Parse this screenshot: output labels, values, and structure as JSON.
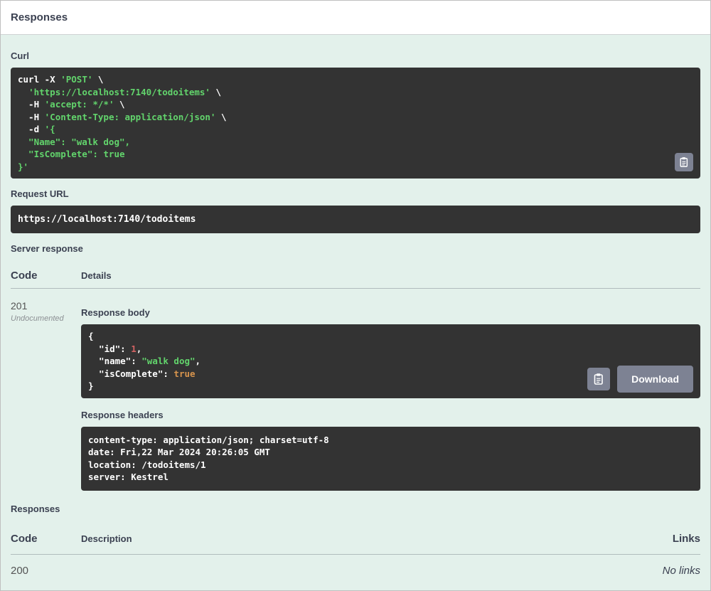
{
  "colors": {
    "section_background": "#e3f1eb",
    "code_background": "#333333",
    "string_green": "#62d46c",
    "number_red": "#d36363",
    "boolean_orange": "#d7944d",
    "button_gray": "#7d8293",
    "heading_text": "#3b4151"
  },
  "header": {
    "title": "Responses"
  },
  "curl": {
    "label": "Curl",
    "tokens": [
      [
        {
          "t": "curl -X ",
          "c": "plain"
        },
        {
          "t": "'POST'",
          "c": "string"
        },
        {
          "t": " \\",
          "c": "plain"
        }
      ],
      [
        {
          "t": "  ",
          "c": "plain"
        },
        {
          "t": "'https://localhost:7140/todoitems'",
          "c": "string"
        },
        {
          "t": " \\",
          "c": "plain"
        }
      ],
      [
        {
          "t": "  -H ",
          "c": "plain"
        },
        {
          "t": "'accept: */*'",
          "c": "string"
        },
        {
          "t": " \\",
          "c": "plain"
        }
      ],
      [
        {
          "t": "  -H ",
          "c": "plain"
        },
        {
          "t": "'Content-Type: application/json'",
          "c": "string"
        },
        {
          "t": " \\",
          "c": "plain"
        }
      ],
      [
        {
          "t": "  -d ",
          "c": "plain"
        },
        {
          "t": "'{",
          "c": "string"
        }
      ],
      [
        {
          "t": "  \"Name\": \"walk dog\",",
          "c": "string"
        }
      ],
      [
        {
          "t": "  \"IsComplete\": true",
          "c": "string"
        }
      ],
      [
        {
          "t": "}'",
          "c": "string"
        }
      ]
    ]
  },
  "request_url": {
    "label": "Request URL",
    "value": "https://localhost:7140/todoitems"
  },
  "server_response": {
    "label": "Server response",
    "columns": {
      "code": "Code",
      "details": "Details"
    },
    "code": "201",
    "code_note": "Undocumented",
    "response_body": {
      "label": "Response body",
      "tokens": [
        [
          {
            "t": "{",
            "c": "plain"
          }
        ],
        [
          {
            "t": "  \"id\": ",
            "c": "plain"
          },
          {
            "t": "1",
            "c": "number"
          },
          {
            "t": ",",
            "c": "plain"
          }
        ],
        [
          {
            "t": "  \"name\": ",
            "c": "plain"
          },
          {
            "t": "\"walk dog\"",
            "c": "string"
          },
          {
            "t": ",",
            "c": "plain"
          }
        ],
        [
          {
            "t": "  \"isComplete\": ",
            "c": "plain"
          },
          {
            "t": "true",
            "c": "boolean"
          }
        ],
        [
          {
            "t": "}",
            "c": "plain"
          }
        ]
      ]
    },
    "download_label": "Download",
    "response_headers": {
      "label": "Response headers",
      "tokens": [
        [
          {
            "t": "content-type: application/json; charset=utf-8 ",
            "c": "plain"
          }
        ],
        [
          {
            "t": "date: Fri,22 Mar 2024 20:26:05 GMT ",
            "c": "plain"
          }
        ],
        [
          {
            "t": "location: /todoitems/1 ",
            "c": "plain"
          }
        ],
        [
          {
            "t": "server: Kestrel ",
            "c": "plain"
          }
        ]
      ]
    }
  },
  "responses_table": {
    "label": "Responses",
    "columns": [
      "Code",
      "Description",
      "Links"
    ],
    "rows": [
      {
        "code": "200",
        "description": "",
        "links": "No links"
      }
    ]
  }
}
